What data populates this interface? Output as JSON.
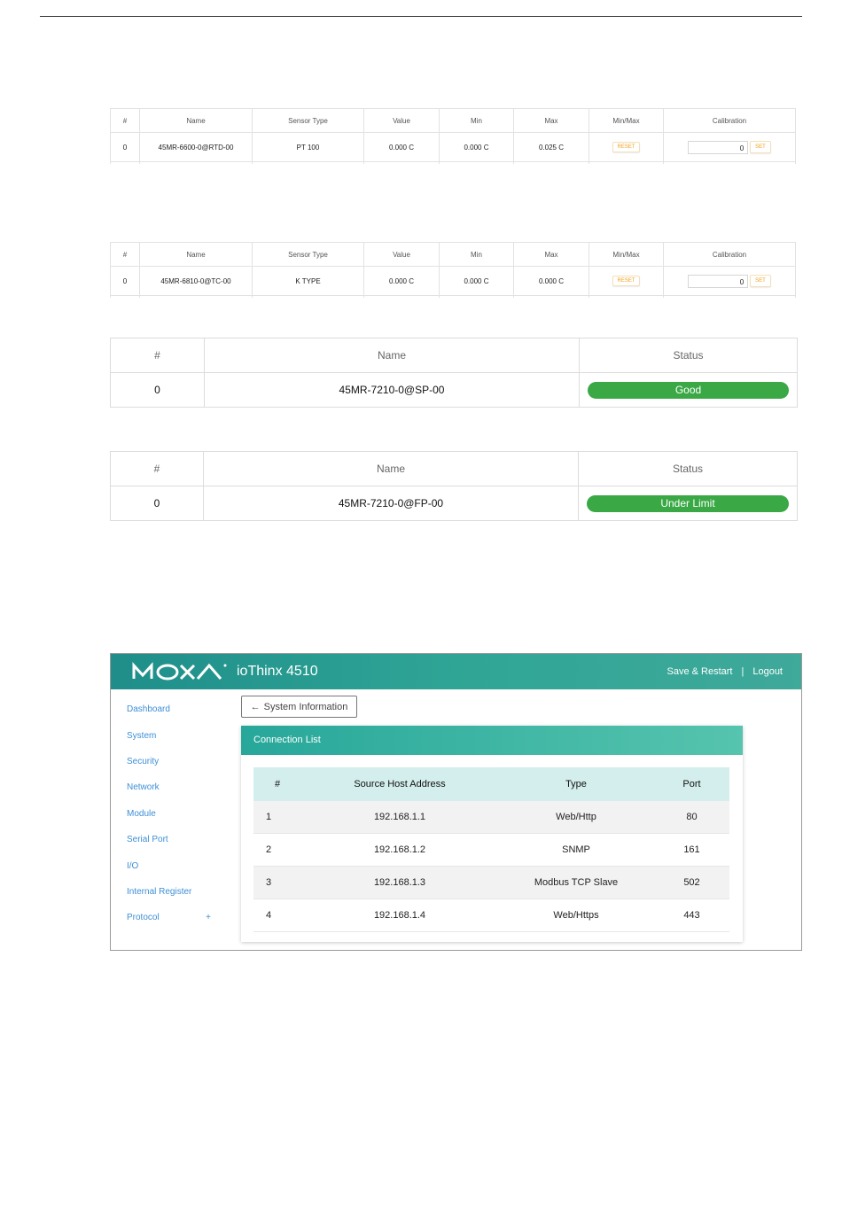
{
  "rtd_table": {
    "headers": [
      "#",
      "Name",
      "Sensor Type",
      "Value",
      "Min",
      "Max",
      "Min/Max",
      "Calibration"
    ],
    "row": {
      "index": "0",
      "name": "45MR-6600-0@RTD-00",
      "sensor_type": "PT 100",
      "value": "0.000 C",
      "min": "0.000 C",
      "max": "0.025 C",
      "reset_label": "RESET",
      "calibration_value": "0",
      "set_label": "SET"
    }
  },
  "tc_table": {
    "headers": [
      "#",
      "Name",
      "Sensor Type",
      "Value",
      "Min",
      "Max",
      "Min/Max",
      "Calibration"
    ],
    "row": {
      "index": "0",
      "name": "45MR-6810-0@TC-00",
      "sensor_type": "K TYPE",
      "value": "0.000 C",
      "min": "0.000 C",
      "max": "0.000 C",
      "reset_label": "RESET",
      "calibration_value": "0",
      "set_label": "SET"
    }
  },
  "sp_table": {
    "headers": [
      "#",
      "Name",
      "Status"
    ],
    "row": {
      "index": "0",
      "name": "45MR-7210-0@SP-00",
      "status": "Good"
    }
  },
  "fp_table": {
    "headers": [
      "#",
      "Name",
      "Status"
    ],
    "row": {
      "index": "0",
      "name": "45MR-7210-0@FP-00",
      "status": "Under Limit"
    }
  },
  "colors": {
    "status_green": "#39a845",
    "header_teal": "#2fa596",
    "link_blue": "#3d8fd6",
    "button_orange": "#f0a21a"
  },
  "moxa": {
    "app_title": "ioThinx 4510",
    "header_links": {
      "save": "Save & Restart",
      "separator": "|",
      "logout": "Logout"
    },
    "sidebar": [
      {
        "label": "Dashboard"
      },
      {
        "label": "System"
      },
      {
        "label": "Security"
      },
      {
        "label": "Network"
      },
      {
        "label": "Module"
      },
      {
        "label": "Serial Port"
      },
      {
        "label": "I/O"
      },
      {
        "label": "Internal Register"
      },
      {
        "label": "Protocol",
        "expand": "+"
      }
    ],
    "back_button": {
      "icon": "arrow-left-icon",
      "label": "System Information"
    },
    "card_title": "Connection List",
    "table": {
      "headers": [
        "#",
        "Source Host Address",
        "Type",
        "Port"
      ],
      "rows": [
        {
          "num": "1",
          "address": "192.168.1.1",
          "type": "Web/Http",
          "port": "80"
        },
        {
          "num": "2",
          "address": "192.168.1.2",
          "type": "SNMP",
          "port": "161"
        },
        {
          "num": "3",
          "address": "192.168.1.3",
          "type": "Modbus TCP Slave",
          "port": "502"
        },
        {
          "num": "4",
          "address": "192.168.1.4",
          "type": "Web/Https",
          "port": "443"
        }
      ]
    }
  }
}
